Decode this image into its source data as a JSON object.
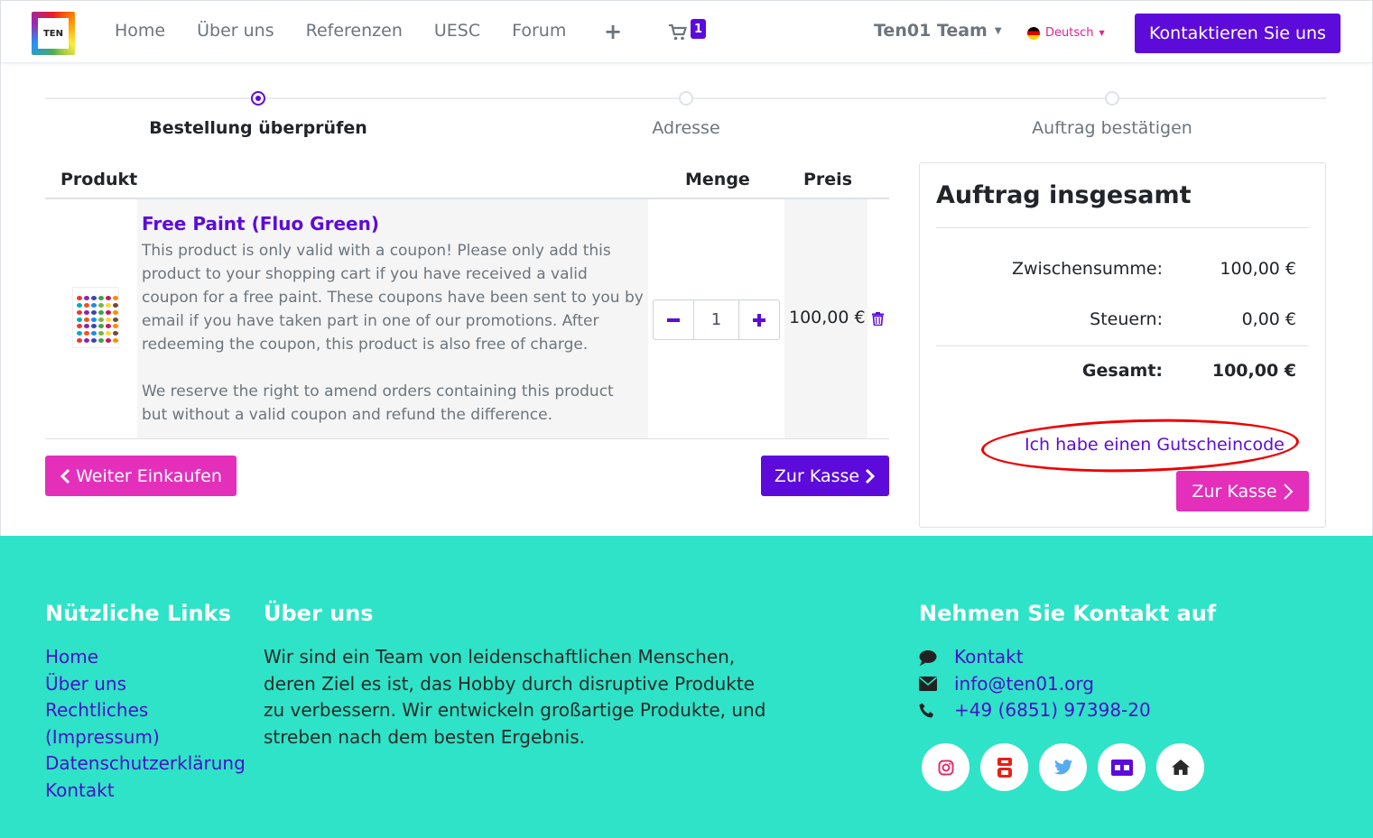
{
  "navbar": {
    "logo_text": "TEN",
    "links": [
      "Home",
      "Über uns",
      "Referenzen",
      "UESC",
      "Forum"
    ],
    "plus_label": "+",
    "cart_count": "1",
    "team_label": "Ten01 Team",
    "language": "Deutsch",
    "contact_button": "Kontaktieren Sie uns"
  },
  "stepper": {
    "steps": [
      "Bestellung überprüfen",
      "Adresse",
      "Auftrag bestätigen"
    ],
    "active_index": 0
  },
  "cart": {
    "headers": {
      "product": "Produkt",
      "quantity": "Menge",
      "price": "Preis"
    },
    "item": {
      "title": "Free Paint (Fluo Green)",
      "description_1": "This product is only valid with a coupon! Please only add this product to your shopping cart if you have received a valid coupon for a free paint. These coupons have been sent to you by email if you have taken part in one of our promotions. After redeeming the coupon, this product is also free of charge.",
      "description_2": "We reserve the right to amend orders containing this product but without a valid coupon and refund the difference.",
      "quantity": "1",
      "price": "100,00 €"
    },
    "continue_button": "Weiter Einkaufen",
    "checkout_button": "Zur Kasse"
  },
  "summary": {
    "title": "Auftrag insgesamt",
    "subtotal_label": "Zwischensumme:",
    "subtotal_value": "100,00 €",
    "tax_label": "Steuern:",
    "tax_value": "0,00 €",
    "total_label": "Gesamt:",
    "total_value": "100,00 €",
    "coupon_link": "Ich habe einen Gutscheincode",
    "checkout_button": "Zur Kasse"
  },
  "footer": {
    "links_heading": "Nützliche Links",
    "links": [
      "Home",
      "Über uns",
      "Rechtliches (Impressum)",
      "Datenschutzerklärung",
      "Kontakt"
    ],
    "about_heading": "Über uns",
    "about_text": "Wir sind ein Team von leidenschaftlichen Menschen, deren Ziel es ist, das Hobby durch disruptive Produkte zu verbessern. Wir entwickeln großartige Produkte, und streben nach dem besten Ergebnis.",
    "contact_heading": "Nehmen Sie Kontakt auf",
    "contact_link": "Kontakt",
    "email": "info@ten01.org",
    "phone": "+49 (6851) 97398-20",
    "social_icons": [
      "instagram-icon",
      "youtube-icon",
      "twitter-icon",
      "myminifactory-icon",
      "home-icon"
    ]
  },
  "colors": {
    "primary": "#5c0bdb",
    "accent_pink": "#e42fbb",
    "footer_bg": "#2ee3c7",
    "annotation_red": "#ee0000"
  }
}
